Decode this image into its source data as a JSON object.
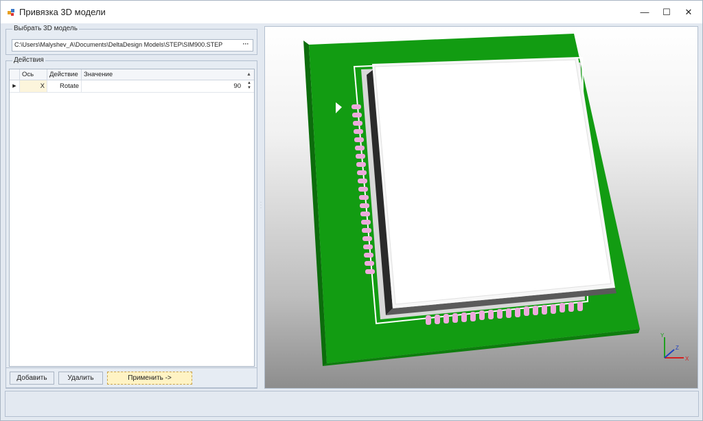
{
  "window": {
    "title": "Привязка 3D модели",
    "minimize_glyph": "—",
    "maximize_glyph": "☐",
    "close_glyph": "✕"
  },
  "model_select": {
    "group_title": "Выбрать 3D модель",
    "path": "C:\\Users\\Malyshev_A\\Documents\\DeltaDesign Models\\STEP\\SIM900.STEP",
    "browse_label": "···"
  },
  "actions": {
    "group_title": "Действия",
    "columns": [
      "Ось",
      "Действие",
      "Значение"
    ],
    "rows": [
      {
        "axis": "X",
        "action": "Rotate",
        "value": "90"
      }
    ],
    "row_indicator": "▶"
  },
  "buttons": {
    "add": "Добавить",
    "delete": "Удалить",
    "apply": "Применить ->"
  },
  "viewport": {
    "axis_labels": {
      "x": "X",
      "y": "Y",
      "z": "Z"
    },
    "colors": {
      "pcb": "#129c12",
      "pads": "#eeaadd",
      "chip_body": "#f7f7f7",
      "axis_x": "#d42020",
      "axis_y": "#20a020",
      "axis_z": "#2040c0"
    }
  }
}
